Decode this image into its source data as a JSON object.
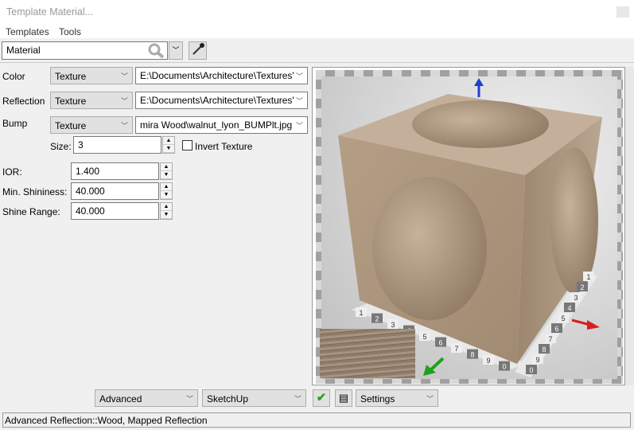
{
  "window": {
    "title": "Template Material..."
  },
  "menu": {
    "items": [
      "Templates",
      "Tools"
    ]
  },
  "toolbar": {
    "material_value": "Material"
  },
  "rows": [
    {
      "label": "Color",
      "type": "Texture",
      "path": "E:\\Documents\\Architecture\\Textures'"
    },
    {
      "label": "Reflection",
      "type": "Texture",
      "path": "E:\\Documents\\Architecture\\Textures'"
    },
    {
      "label": "Bump",
      "type": "Texture",
      "path": "mira Wood\\walnut_lyon_BUMPlt.jpg"
    }
  ],
  "bump": {
    "size_label": "Size:",
    "size_value": "3",
    "invert_label": "Invert Texture",
    "invert_checked": false
  },
  "params": [
    {
      "label": "IOR:",
      "value": "1.400"
    },
    {
      "label": "Min. Shininess:",
      "value": "40.000"
    },
    {
      "label": "Shine Range:",
      "value": "40.000"
    }
  ],
  "preview": {
    "axis_numbers_left": [
      "1",
      "2",
      "3",
      "4",
      "5",
      "6",
      "7",
      "8",
      "9",
      "0"
    ],
    "axis_numbers_right": [
      "1",
      "2",
      "3",
      "4",
      "5",
      "6",
      "7",
      "8",
      "9",
      "0"
    ],
    "axis_colors": {
      "x": "#d42020",
      "y": "#20a020",
      "z": "#2040d0"
    }
  },
  "bottom": {
    "mode": "Advanced",
    "renderer": "SketchUp",
    "settings": "Settings"
  },
  "status": {
    "text": "Advanced Reflection::Wood, Mapped Reflection"
  }
}
